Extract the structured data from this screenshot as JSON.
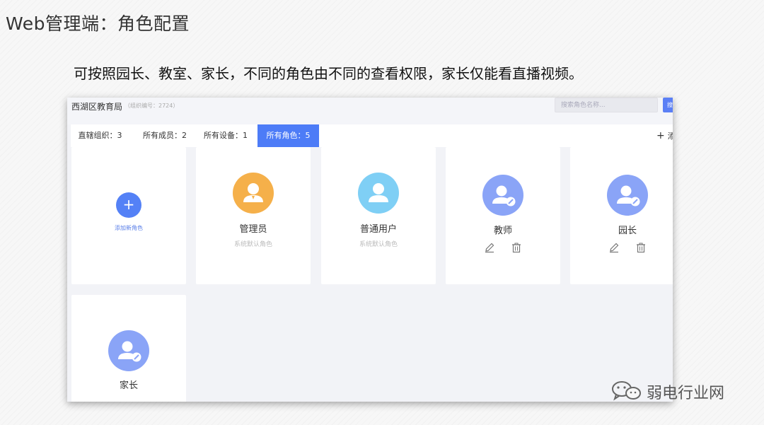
{
  "slide": {
    "title": "Web管理端：角色配置",
    "subtitle": "可按照园长、教室、家长，不同的角色由不同的查看权限，家长仅能看直播视频。"
  },
  "header": {
    "org_name": "西湖区教育局",
    "org_code": "（组织编号：2724）",
    "search_placeholder": "搜索角色名称...",
    "search_button": "搜"
  },
  "tabs": [
    {
      "label": "直辖组织：3",
      "active": false
    },
    {
      "label": "所有成员：2",
      "active": false
    },
    {
      "label": "所有设备：1",
      "active": false
    },
    {
      "label": "所有角色：5",
      "active": true
    }
  ],
  "add_link": "添",
  "new_role": {
    "label": "添加新角色",
    "icon": "plus-icon"
  },
  "roles": [
    {
      "name": "管理员",
      "desc": "系统默认角色",
      "avatar_color": "#f5b04a",
      "editable": false
    },
    {
      "name": "普通用户",
      "desc": "系统默认角色",
      "avatar_color": "#7fcff5",
      "editable": false
    },
    {
      "name": "教师",
      "desc": "",
      "avatar_color": "#8aa4f7",
      "editable": true
    },
    {
      "name": "园长",
      "desc": "",
      "avatar_color": "#8aa4f7",
      "editable": true
    },
    {
      "name": "家长",
      "desc": "",
      "avatar_color": "#8aa4f7",
      "editable": true
    }
  ],
  "watermark": {
    "text": "弱电行业网",
    "icon": "wechat-icon"
  }
}
